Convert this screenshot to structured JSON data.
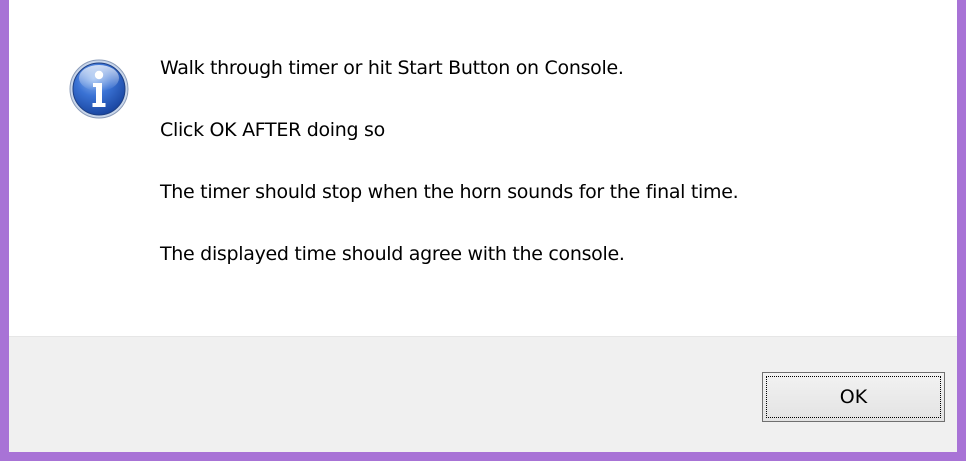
{
  "dialog": {
    "icon": "information-icon",
    "messages": [
      "Walk through timer or hit Start Button on Console.",
      "Click OK AFTER doing so",
      "The timer should stop when the horn sounds for the final time.",
      "The displayed time should agree with the console."
    ],
    "ok_label": "OK"
  },
  "colors": {
    "window_border": "#a873d6",
    "footer_background": "#f0f0f0",
    "icon_blue": "#2a5fc4"
  }
}
